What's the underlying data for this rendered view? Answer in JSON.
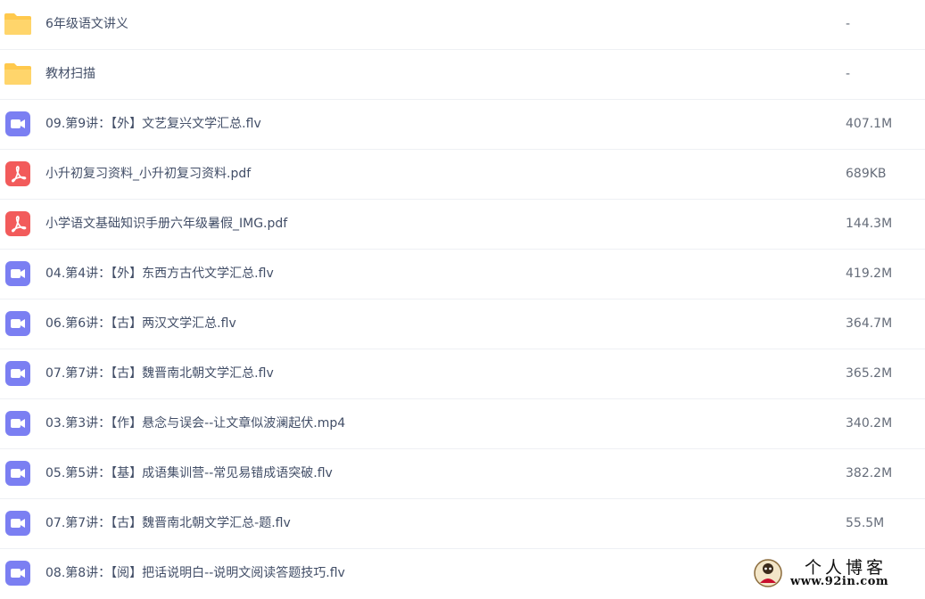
{
  "files": [
    {
      "type": "folder",
      "icon": "folder-icon",
      "name": "6年级语文讲义",
      "size": "-"
    },
    {
      "type": "folder",
      "icon": "folder-icon",
      "name": "教材扫描",
      "size": "-"
    },
    {
      "type": "video",
      "icon": "video-file-icon",
      "name": "09.第9讲：【外】文艺复兴文学汇总.flv",
      "size": "407.1M"
    },
    {
      "type": "pdf",
      "icon": "pdf-file-icon",
      "name": "小升初复习资料_小升初复习资料.pdf",
      "size": "689KB"
    },
    {
      "type": "pdf",
      "icon": "pdf-file-icon",
      "name": "小学语文基础知识手册六年级暑假_IMG.pdf",
      "size": "144.3M"
    },
    {
      "type": "video",
      "icon": "video-file-icon",
      "name": "04.第4讲：【外】东西方古代文学汇总.flv",
      "size": "419.2M"
    },
    {
      "type": "video",
      "icon": "video-file-icon",
      "name": "06.第6讲：【古】两汉文学汇总.flv",
      "size": "364.7M"
    },
    {
      "type": "video",
      "icon": "video-file-icon",
      "name": "07.第7讲：【古】魏晋南北朝文学汇总.flv",
      "size": "365.2M"
    },
    {
      "type": "video",
      "icon": "video-file-icon",
      "name": "03.第3讲：【作】悬念与误会--让文章似波澜起伏.mp4",
      "size": "340.2M"
    },
    {
      "type": "video",
      "icon": "video-file-icon",
      "name": "05.第5讲：【基】成语集训营--常见易错成语突破.flv",
      "size": "382.2M"
    },
    {
      "type": "video",
      "icon": "video-file-icon",
      "name": "07.第7讲：【古】魏晋南北朝文学汇总-题.flv",
      "size": "55.5M"
    },
    {
      "type": "video",
      "icon": "video-file-icon",
      "name": "08.第8讲：【阅】把话说明白--说明文阅读答题技巧.flv",
      "size": ""
    }
  ],
  "colors": {
    "folder": "#ffc94d",
    "video": "#7b7ff2",
    "pdf": "#f25b5b",
    "text": "#424e67",
    "size_text": "#666d7a",
    "divider": "#eef0f4"
  },
  "watermark": {
    "title": "个人博客",
    "url": "www.92in.com"
  }
}
